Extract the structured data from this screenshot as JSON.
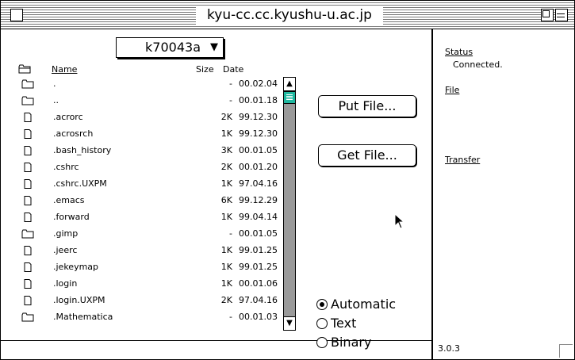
{
  "window": {
    "title": "kyu-cc.cc.kyushu-u.ac.jp"
  },
  "directory_popup": {
    "label": "k70043a"
  },
  "columns": {
    "name": "Name",
    "size": "Size",
    "date": "Date"
  },
  "files": [
    {
      "name": ".",
      "size": "-",
      "date": "00.02.04",
      "kind": "folder"
    },
    {
      "name": "..",
      "size": "-",
      "date": "00.01.18",
      "kind": "folder"
    },
    {
      "name": ".acrorc",
      "size": "2K",
      "date": "99.12.30",
      "kind": "file"
    },
    {
      "name": ".acrosrch",
      "size": "1K",
      "date": "99.12.30",
      "kind": "file"
    },
    {
      "name": ".bash_history",
      "size": "3K",
      "date": "00.01.05",
      "kind": "file"
    },
    {
      "name": ".cshrc",
      "size": "2K",
      "date": "00.01.20",
      "kind": "file"
    },
    {
      "name": ".cshrc.UXPM",
      "size": "1K",
      "date": "97.04.16",
      "kind": "file"
    },
    {
      "name": ".emacs",
      "size": "6K",
      "date": "99.12.29",
      "kind": "file"
    },
    {
      "name": ".forward",
      "size": "1K",
      "date": "99.04.14",
      "kind": "file"
    },
    {
      "name": ".gimp",
      "size": "-",
      "date": "00.01.05",
      "kind": "folder"
    },
    {
      "name": ".jeerc",
      "size": "1K",
      "date": "99.01.25",
      "kind": "file"
    },
    {
      "name": ".jekeymap",
      "size": "1K",
      "date": "99.01.25",
      "kind": "file"
    },
    {
      "name": ".login",
      "size": "1K",
      "date": "00.01.06",
      "kind": "file"
    },
    {
      "name": ".login.UXPM",
      "size": "2K",
      "date": "97.04.16",
      "kind": "file"
    },
    {
      "name": ".Mathematica",
      "size": "-",
      "date": "00.01.03",
      "kind": "folder"
    }
  ],
  "buttons": {
    "put_file": "Put File...",
    "get_file": "Get File..."
  },
  "transfer_mode": {
    "options": [
      "Automatic",
      "Text",
      "Binary"
    ],
    "selected": "Automatic"
  },
  "side_panel": {
    "status_label": "Status",
    "status_value": "Connected.",
    "file_label": "File",
    "transfer_label": "Transfer",
    "version": "3.0.3"
  },
  "colors": {
    "scroll_thumb": "#20b8a0"
  }
}
